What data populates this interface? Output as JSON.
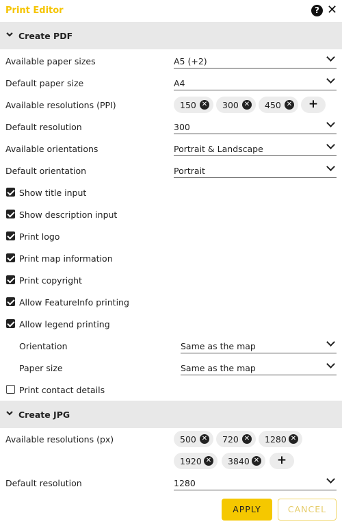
{
  "window": {
    "title": "Print Editor",
    "help_glyph": "?",
    "close_glyph": "✕"
  },
  "pdf": {
    "header": "Create PDF",
    "available_paper_sizes": {
      "label": "Available paper sizes",
      "value": "A5 (+2)"
    },
    "default_paper_size": {
      "label": "Default paper size",
      "value": "A4"
    },
    "available_resolutions": {
      "label": "Available resolutions (PPI)",
      "chips": [
        "150",
        "300",
        "450"
      ]
    },
    "default_resolution": {
      "label": "Default resolution",
      "value": "300"
    },
    "available_orientations": {
      "label": "Available orientations",
      "value": "Portrait & Landscape"
    },
    "default_orientation": {
      "label": "Default orientation",
      "value": "Portrait"
    },
    "checkboxes": [
      {
        "label": "Show title input",
        "checked": true
      },
      {
        "label": "Show description input",
        "checked": true
      },
      {
        "label": "Print logo",
        "checked": true
      },
      {
        "label": "Print map information",
        "checked": true
      },
      {
        "label": "Print copyright",
        "checked": true
      },
      {
        "label": "Allow FeatureInfo printing",
        "checked": true
      },
      {
        "label": "Allow legend printing",
        "checked": true
      }
    ],
    "legend_orientation": {
      "label": "Orientation",
      "value": "Same as the map"
    },
    "legend_paper_size": {
      "label": "Paper size",
      "value": "Same as the map"
    },
    "contact_details": {
      "label": "Print contact details",
      "checked": false
    }
  },
  "jpg": {
    "header": "Create JPG",
    "available_resolutions": {
      "label": "Available resolutions (px)",
      "chips": [
        "500",
        "720",
        "1280",
        "1920",
        "3840"
      ]
    },
    "default_resolution": {
      "label": "Default resolution",
      "value": "1280"
    }
  },
  "footer": {
    "apply": "APPLY",
    "cancel": "CANCEL"
  },
  "icons": {
    "remove": "✕",
    "add": "+",
    "collapse": "chevron-down-icon"
  },
  "colors": {
    "accent": "#f5c400",
    "apply_bg": "#f5c800",
    "section_bg": "#e8e8e8"
  }
}
